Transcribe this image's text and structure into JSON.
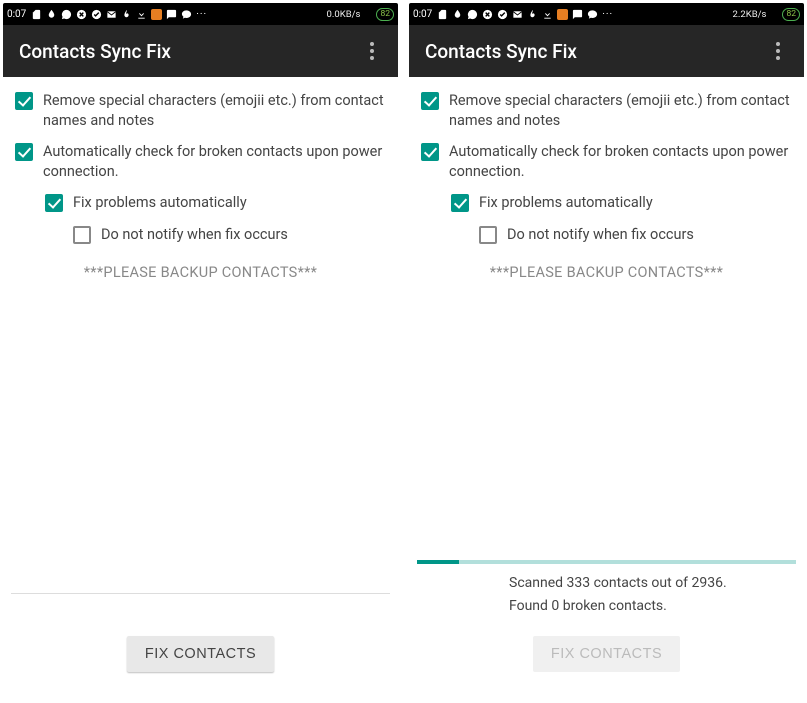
{
  "screens": [
    {
      "status": {
        "time": "0:07",
        "net_speed": "0.0KB/s",
        "battery": "82"
      },
      "app_title": "Contacts Sync Fix",
      "options": [
        {
          "label": "Remove special characters (emojii etc.) from contact names and notes",
          "checked": true,
          "indent": 0
        },
        {
          "label": "Automatically check for broken contacts upon power connection.",
          "checked": true,
          "indent": 0
        },
        {
          "label": "Fix problems automatically",
          "checked": true,
          "indent": 1
        },
        {
          "label": "Do not notify when fix occurs",
          "checked": false,
          "indent": 2
        }
      ],
      "backup_note": "***PLEASE BACKUP CONTACTS***",
      "progress": null,
      "status_lines": [],
      "fix_button": {
        "label": "FIX CONTACTS",
        "enabled": true
      }
    },
    {
      "status": {
        "time": "0:07",
        "net_speed": "2.2KB/s",
        "battery": "82"
      },
      "app_title": "Contacts Sync Fix",
      "options": [
        {
          "label": "Remove special characters (emojii etc.) from contact names and notes",
          "checked": true,
          "indent": 0
        },
        {
          "label": "Automatically check for broken contacts upon power connection.",
          "checked": true,
          "indent": 0
        },
        {
          "label": "Fix problems automatically",
          "checked": true,
          "indent": 1
        },
        {
          "label": "Do not notify when fix occurs",
          "checked": false,
          "indent": 2
        }
      ],
      "backup_note": "***PLEASE BACKUP CONTACTS***",
      "progress": {
        "percent": 11
      },
      "status_lines": [
        "Scanned 333 contacts out of 2936.",
        "Found 0 broken contacts."
      ],
      "fix_button": {
        "label": "FIX CONTACTS",
        "enabled": false
      }
    }
  ]
}
